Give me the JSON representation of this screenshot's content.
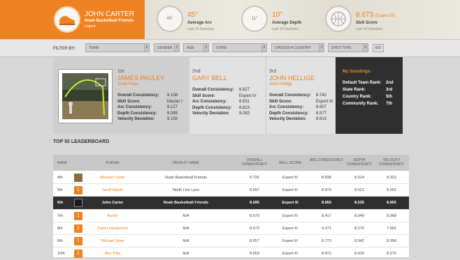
{
  "user": {
    "name": "JOHN CARTER",
    "team": "Noah Basketball Friends",
    "logout": "Logout"
  },
  "stats": [
    {
      "badge": "45°",
      "value": "45°",
      "label": "Average Arc",
      "sub": "Last 10 Sessions"
    },
    {
      "badge": "11\"",
      "value": "10\"",
      "label": "Average Depth",
      "sub": "Last 10 Sessions"
    },
    {
      "badge": "",
      "value": "8.673",
      "value_suffix": "(Expert III)",
      "label": "Skill Score",
      "sub": "Last 10 Sessions"
    }
  ],
  "filters": {
    "label": "FILTER BY:",
    "team": "TEAM",
    "gender": "GENDER",
    "age": "AGE",
    "state": "STATE",
    "country": "CHOOSE A COUNTRY",
    "shot_type": "SHOT TYPE",
    "go": "GO"
  },
  "metric_labels": [
    "Overall Consistency:",
    "Skill Score:",
    "Arc Consistency:",
    "Depth Consistency:",
    "Velocity Deviation:"
  ],
  "podium": [
    {
      "rank": "1st",
      "name": "JAMES PAULEY",
      "team": "Noah Reps",
      "values": [
        "9.108",
        "Master I",
        "9.127",
        "9.089",
        "9.159"
      ]
    },
    {
      "rank": "2nd",
      "name": "GARY BELL",
      "team": "",
      "values": [
        "8.827",
        "Expert IV",
        "8.831",
        "8.823",
        "9.082"
      ]
    },
    {
      "rank": "3rd",
      "name": "JOHN HELLIGE",
      "team": "John Hellige",
      "values": [
        "8.742",
        "Expert III",
        "8.907",
        "8.577",
        "8.913"
      ]
    }
  ],
  "standings": {
    "title": "My Standings:",
    "rows": [
      {
        "label": "Default Team Rank:",
        "value": "2nd"
      },
      {
        "label": "State Rank:",
        "value": "3rd"
      },
      {
        "label": "Country Rank:",
        "value": "5th"
      },
      {
        "label": "Community Rank:",
        "value": "7th"
      }
    ]
  },
  "leaderboard": {
    "title": "TOP 50 LEADERBOARD",
    "headers": {
      "rank": "RANK",
      "player": "PLAYER",
      "team": "DEFAULT NAME",
      "overall": "OVERALL CONSISTENCY",
      "skill": "SKILL SCORE",
      "arc": "ARC CONSISTENCY",
      "depth": "DEPTH CONSISTENCY",
      "velocity": "VELOCITY CONSISTENCY"
    },
    "rows": [
      {
        "rank": "4th",
        "player": "Michael Carter",
        "team": "Noah Basketball Friends",
        "overall": "8.726",
        "skill": "Expert III",
        "arc": "8.838",
        "depth": "8.614",
        "velocity": "8.922"
      },
      {
        "rank": "5th",
        "player": "Geoff Martin",
        "team": "North Linn Lynx",
        "overall": "8.697",
        "skill": "Expert III",
        "arc": "8.873",
        "depth": "8.521",
        "velocity": "8.952"
      },
      {
        "rank": "6th",
        "player": "John Carter",
        "team": "Noah Basketball Friends",
        "overall": "8.695",
        "skill": "Expert III",
        "arc": "8.855",
        "depth": "8.535",
        "velocity": "8.855"
      },
      {
        "rank": "7th",
        "player": "Austin",
        "team": "N/A",
        "overall": "8.679",
        "skill": "Expert III",
        "arc": "8.417",
        "depth": "8.940",
        "velocity": "8.968"
      },
      {
        "rank": "8th",
        "player": "Carter Henderson",
        "team": "N/A",
        "overall": "8.673",
        "skill": "Expert III",
        "arc": "9.071",
        "depth": "8.276",
        "velocity": "7.991"
      },
      {
        "rank": "9th",
        "player": "Michael Shea",
        "team": "N/A",
        "overall": "8.657",
        "skill": "Expert III",
        "arc": "8.773",
        "depth": "8.542",
        "velocity": "8.958"
      },
      {
        "rank": "10th",
        "player": "Alec Pitts",
        "team": "N/A",
        "overall": "8.653",
        "skill": "Expert III",
        "arc": "8.872",
        "depth": "8.433",
        "velocity": "8.575"
      }
    ]
  }
}
